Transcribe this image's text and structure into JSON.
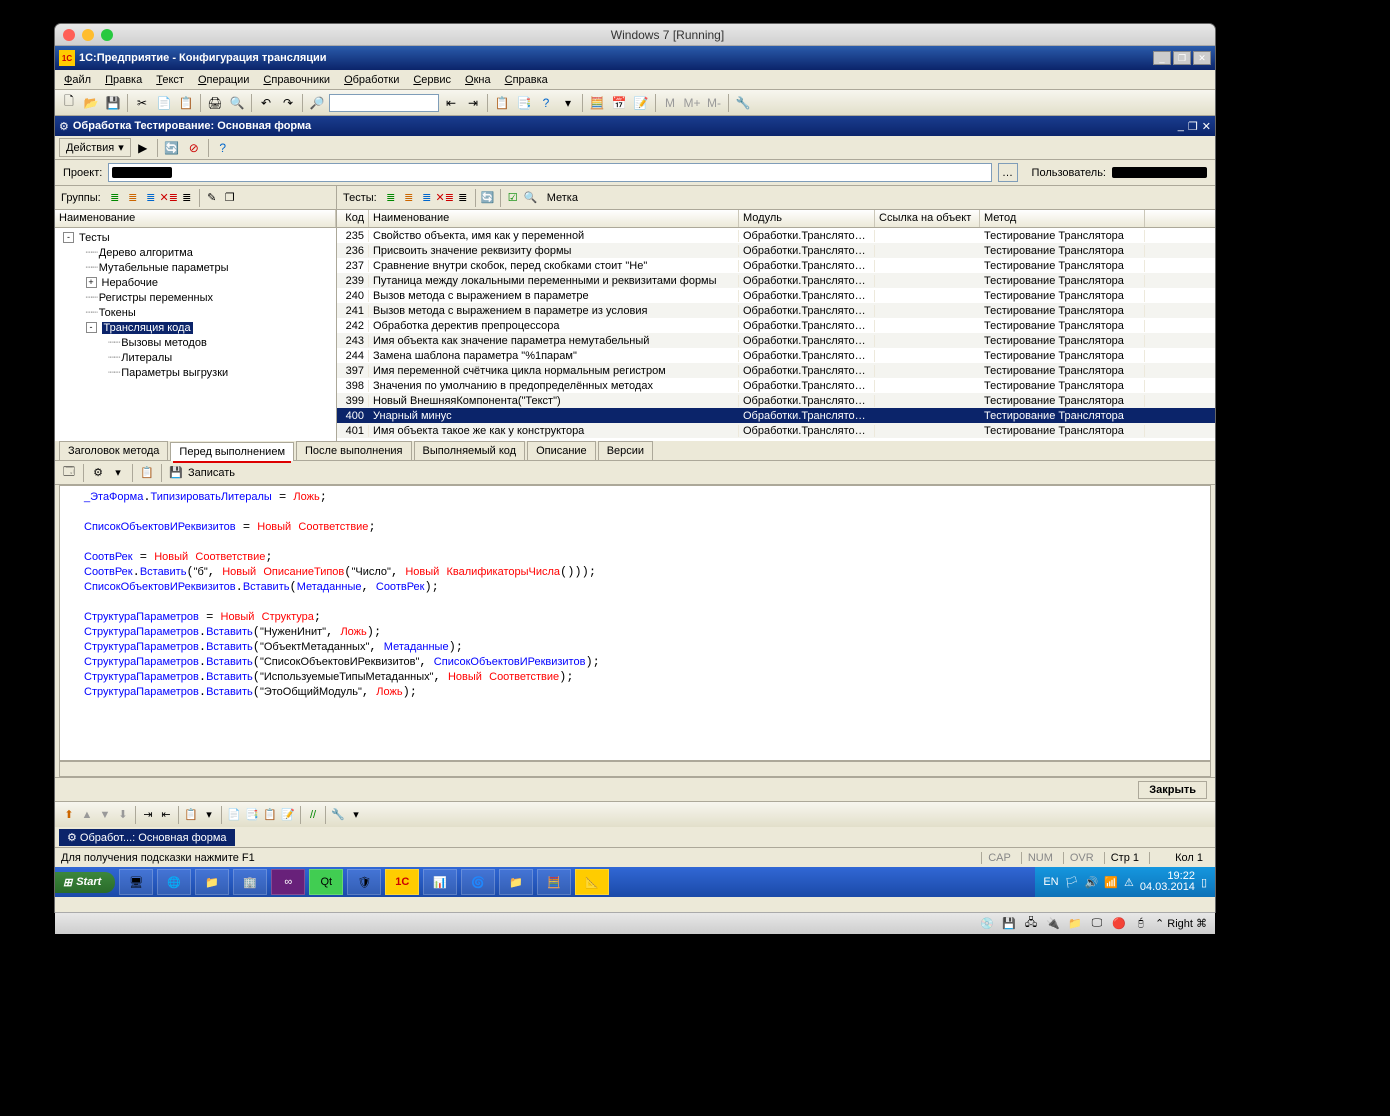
{
  "mac": {
    "title": "Windows 7 [Running]"
  },
  "app": {
    "title": "1С:Предприятие - Конфигурация трансляции"
  },
  "menu": [
    "Файл",
    "Правка",
    "Текст",
    "Операции",
    "Справочники",
    "Обработки",
    "Сервис",
    "Окна",
    "Справка"
  ],
  "subwindow": {
    "icon": "⚙",
    "title": "Обработка Тестирование: Основная форма"
  },
  "actions": {
    "label": "Действия",
    "arrow": "▾"
  },
  "project": {
    "label": "Проект:",
    "user_label": "Пользователь:"
  },
  "groups": {
    "label": "Группы:"
  },
  "tests": {
    "label": "Тесты:",
    "mark_label": "Метка"
  },
  "tree_header": "Наименование",
  "tree": [
    {
      "depth": 0,
      "exp": "-",
      "label": "Тесты"
    },
    {
      "depth": 1,
      "exp": "",
      "label": "Дерево алгоритма"
    },
    {
      "depth": 1,
      "exp": "",
      "label": "Мутабельные параметры"
    },
    {
      "depth": 1,
      "exp": "+",
      "label": "Нерабочие"
    },
    {
      "depth": 1,
      "exp": "",
      "label": "Регистры переменных"
    },
    {
      "depth": 1,
      "exp": "",
      "label": "Токены"
    },
    {
      "depth": 1,
      "exp": "-",
      "label": "Трансляция кода",
      "sel": true
    },
    {
      "depth": 2,
      "exp": "",
      "label": "Вызовы методов"
    },
    {
      "depth": 2,
      "exp": "",
      "label": "Литералы"
    },
    {
      "depth": 2,
      "exp": "",
      "label": "Параметры выгрузки"
    }
  ],
  "grid_headers": {
    "code": "Код",
    "name": "Наименование",
    "mod": "Модуль",
    "link": "Ссылка на объект",
    "meth": "Метод"
  },
  "grid": [
    {
      "code": "235",
      "name": "Свойство объекта, имя как у переменной",
      "mod": "Обработки.Транслятор.Фор...",
      "meth": "Тестирование Транслятора"
    },
    {
      "code": "236",
      "name": "Присвоить значение реквизиту формы",
      "mod": "Обработки.Транслятор.Фор...",
      "meth": "Тестирование Транслятора"
    },
    {
      "code": "237",
      "name": "Сравнение внутри скобок, перед скобками стоит \"Не\"",
      "mod": "Обработки.Транслятор.Фор...",
      "meth": "Тестирование Транслятора"
    },
    {
      "code": "239",
      "name": "Путаница между локальными переменными и реквизитами формы",
      "mod": "Обработки.Транслятор.Фор...",
      "meth": "Тестирование Транслятора"
    },
    {
      "code": "240",
      "name": "Вызов метода с выражением в параметре",
      "mod": "Обработки.Транслятор.Фор...",
      "meth": "Тестирование Транслятора"
    },
    {
      "code": "241",
      "name": "Вызов метода с выражением в параметре из условия",
      "mod": "Обработки.Транслятор.Фор...",
      "meth": "Тестирование Транслятора"
    },
    {
      "code": "242",
      "name": "Обработка деректив препроцессора",
      "mod": "Обработки.Транслятор.Фор...",
      "meth": "Тестирование Транслятора"
    },
    {
      "code": "243",
      "name": "Имя объекта как значение параметра немутабельный",
      "mod": "Обработки.Транслятор.Фор...",
      "meth": "Тестирование Транслятора"
    },
    {
      "code": "244",
      "name": "Замена шаблона параметра \"%1парам\"",
      "mod": "Обработки.Транслятор.Фор...",
      "meth": "Тестирование Транслятора"
    },
    {
      "code": "397",
      "name": "Имя переменной счётчика цикла нормальным регистром",
      "mod": "Обработки.Транслятор.Фор...",
      "meth": "Тестирование Транслятора"
    },
    {
      "code": "398",
      "name": "Значения по умолчанию в предопределённых методах",
      "mod": "Обработки.Транслятор.Фор...",
      "meth": "Тестирование Транслятора"
    },
    {
      "code": "399",
      "name": "Новый ВнешняяКомпонента(\"Текст\")",
      "mod": "Обработки.Транслятор.Фор...",
      "meth": "Тестирование Транслятора"
    },
    {
      "code": "400",
      "name": "Унарный минус",
      "mod": "Обработки.Транслятор.Фор...",
      "meth": "Тестирование Транслятора",
      "sel": true
    },
    {
      "code": "401",
      "name": "Имя объекта такое же как у конструктора",
      "mod": "Обработки.Транслятор.Фор...",
      "meth": "Тестирование Транслятора"
    }
  ],
  "tabs": [
    {
      "label": "Заголовок метода"
    },
    {
      "label": "Перед выполнением",
      "active": true,
      "underline": true
    },
    {
      "label": "После выполнения"
    },
    {
      "label": "Выполняемый код"
    },
    {
      "label": "Описание"
    },
    {
      "label": "Версии"
    }
  ],
  "code_toolbar": {
    "save": "Записать"
  },
  "close": "Закрыть",
  "doc_tab": "⚙ Обработ...: Основная форма",
  "status": {
    "hint": "Для получения подсказки нажмите F1",
    "cap": "CAP",
    "num": "NUM",
    "ovr": "OVR",
    "str": "Стр 1",
    "col": "Кол 1"
  },
  "taskbar": {
    "start": "Start",
    "lang": "EN",
    "time": "19:22",
    "date": "04.03.2014"
  },
  "mac_status": {
    "right": "Right ⌘"
  }
}
